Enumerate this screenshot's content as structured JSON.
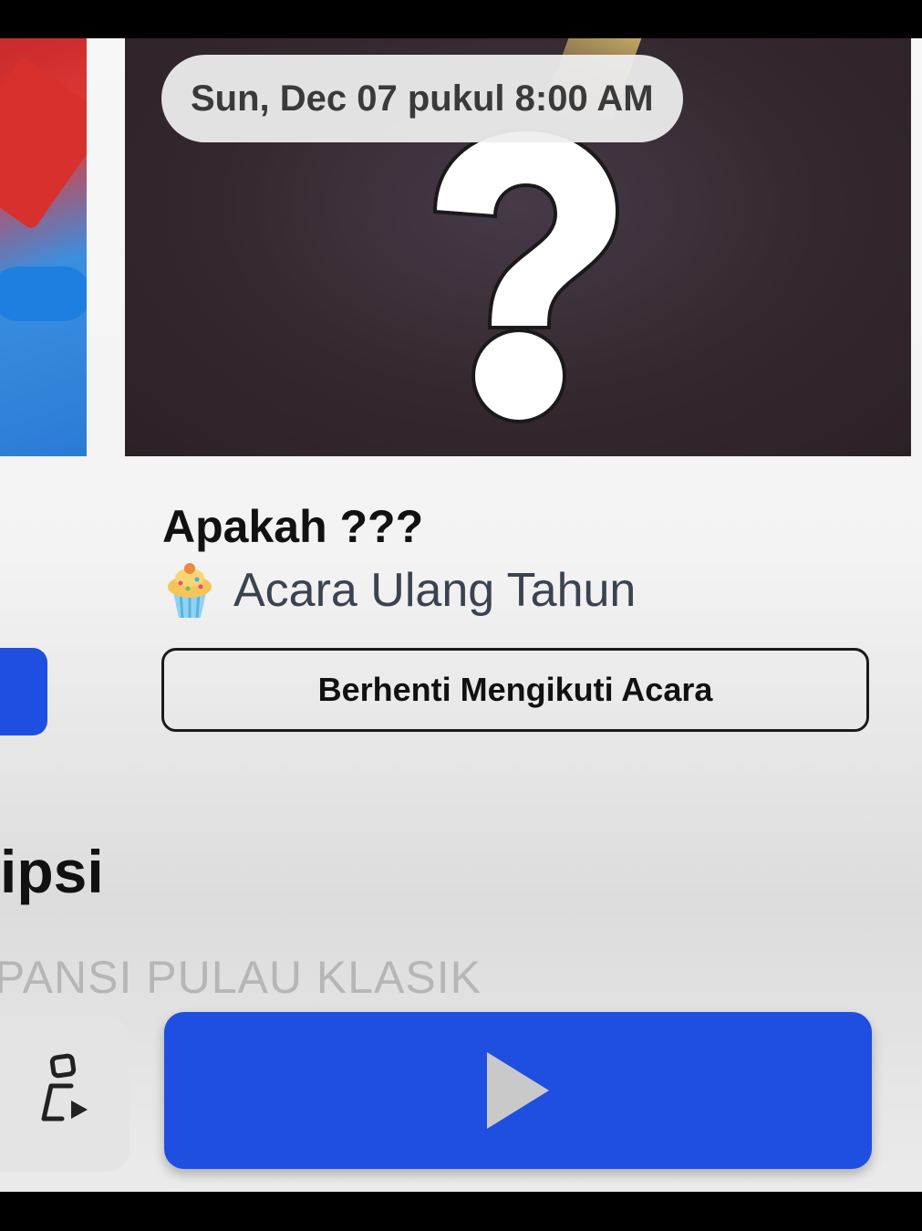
{
  "event": {
    "date_label": "Sun, Dec 07 pukul 8:00 AM",
    "title": "Apakah ???",
    "category": "Acara Ulang Tahun",
    "category_icon": "cupcake-icon"
  },
  "actions": {
    "unfollow_label": "Berhenti Mengikuti Acara"
  },
  "description": {
    "heading": "ipsi",
    "text": "PANSI PULAU KLASIK"
  },
  "bottom_bar": {
    "secondary_icon": "shapes-play-icon",
    "play_icon": "play-icon"
  },
  "colors": {
    "primary_blue": "#1f4fe0",
    "card_dark": "#34282f"
  }
}
